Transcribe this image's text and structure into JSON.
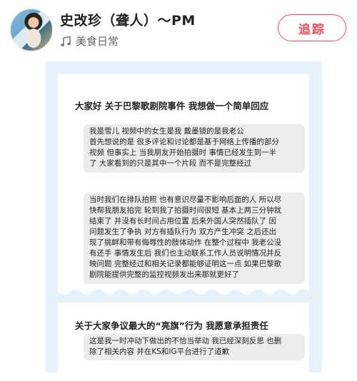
{
  "profile": {
    "name": "史改珍（聋人）～PM",
    "category": "美食日常",
    "follow_label": "追踪"
  },
  "post": {
    "heading1": "大家好 关于巴黎歌剧院事件 我想做一个简单回应",
    "bubble1_lines": [
      "我是雪儿  视频中的女生是我  戴墨镜的是我老公",
      "首先想说的是  很多评论和讨论都是基于网络上传播的部分",
      "视频  但事实上  当我朋友开始拍摄时  事情已经发生到一半",
      "了  大家看到的只是其中一个片段  而不是完整经过"
    ],
    "bubble2_lines": [
      "当时我们在排队拍照  也有意识尽量不影响后面的人  所以尽",
      "快帮我朋友拍完  轮到我了拍摄时间很短  基本上两三分钟就",
      "结束了  并没有长时间占用位置  后来外国人突然插队了  因",
      "问题发生了争执  对方有插队行为  双方产生冲突  之后还出",
      "现了挑衅和带有侮辱性的肢体动作  在整个过程中  我老公没",
      "有还手  事情发生后  我们也主动联系工作人员说明情况并反",
      "映问题  完整经过和相关记录都能够证明这一点  如果巴黎歌",
      "剧院能提供完整的监控视频发出来那就更好了"
    ],
    "heading2": "关于大家争议最大的“亮旗”行为 我愿意承担责任",
    "bubble3_lines": [
      "这是我一时冲动下做出的不恰当举动  我已经深刻反思  也删",
      "除了相关内容  并在KS和IG平台进行了道歉"
    ]
  },
  "colors": {
    "accent": "#f04a5a",
    "card_background": "#e6f1fb",
    "bubble": "#ececec"
  },
  "icons": {
    "category_icon": "music-note-icon"
  }
}
